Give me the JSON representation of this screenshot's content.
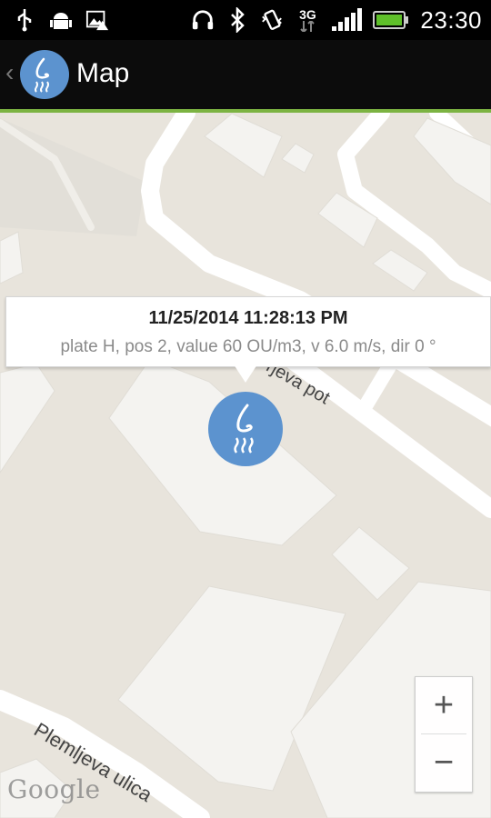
{
  "status_bar": {
    "time": "23:30",
    "network": "3G",
    "left_icons": [
      "usb-icon",
      "android-debug-icon",
      "image-warning-icon"
    ],
    "right_icons": [
      "headphones-icon",
      "bluetooth-icon",
      "vibrate-icon",
      "network-3g-icon",
      "signal-icon",
      "battery-icon"
    ]
  },
  "action_bar": {
    "title": "Map",
    "icon": "nose-smell-icon",
    "back_icon": "chevron-left-icon"
  },
  "map": {
    "info_window": {
      "timestamp": "11/25/2014 11:28:13 PM",
      "details": "plate H, pos 2, value 60 OU/m3, v 6.0 m/s, dir 0 °"
    },
    "marker_icon": "nose-smell-icon",
    "streets": [
      "rjeva pot",
      "Plemljeva ulica"
    ],
    "zoom_in_label": "+",
    "zoom_out_label": "−",
    "attribution": "Google"
  },
  "colors": {
    "accent": "#7cb342",
    "marker": "#5c93cf",
    "map_background": "#e8e4dc",
    "road": "#ffffff",
    "building": "#f4f3f0"
  }
}
